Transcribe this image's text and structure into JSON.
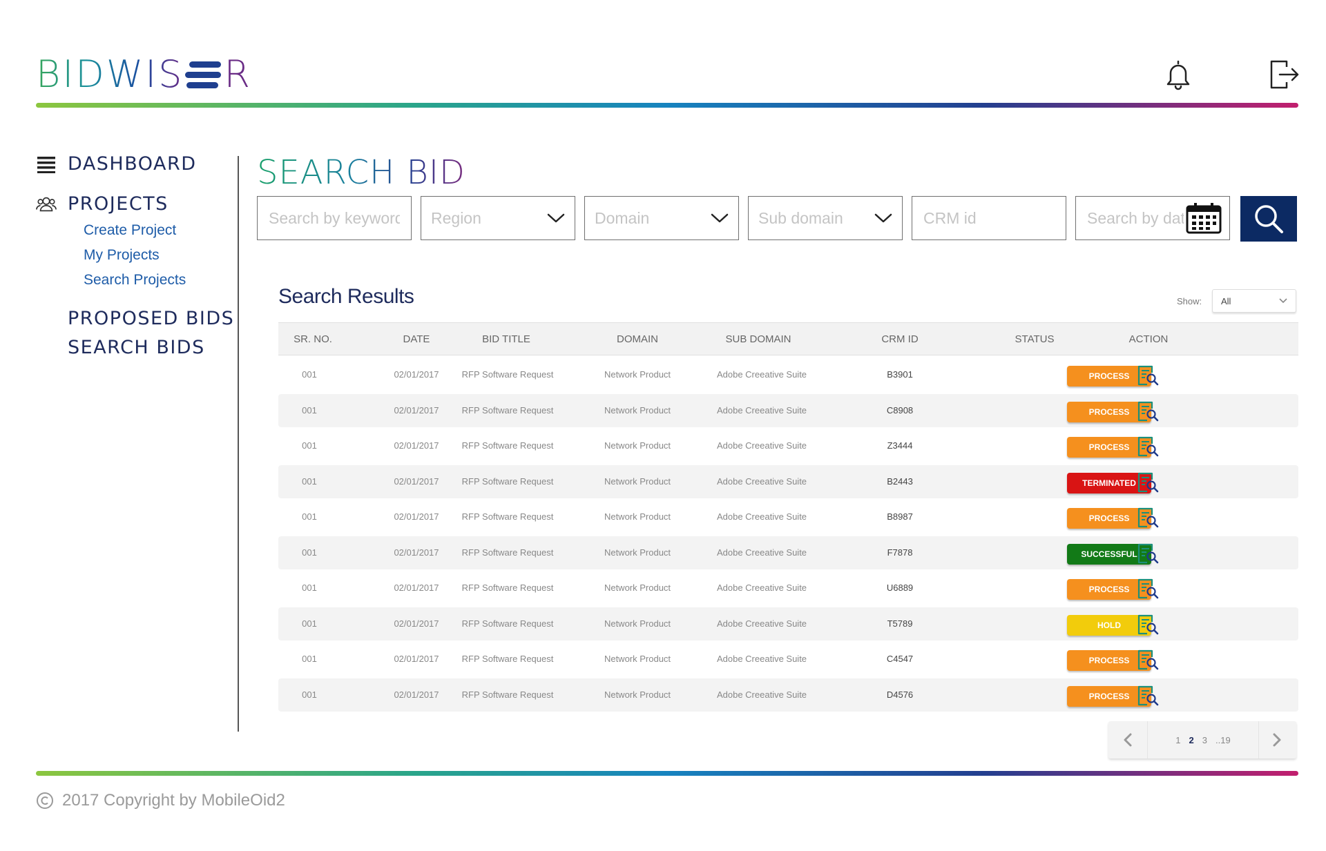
{
  "brand": {
    "logo_left": "BIDWIS",
    "logo_right": "R"
  },
  "header": {
    "bell_icon": "bell-icon",
    "logout_icon": "logout-icon"
  },
  "sidebar": {
    "dashboard": "DASHBOARD",
    "projects": "PROJECTS",
    "project_items": [
      "Create Project",
      "My Projects",
      "Search Projects"
    ],
    "proposed_bids": "PROPOSED BIDS",
    "search_bids": "SEARCH BIDS"
  },
  "page": {
    "title": "SEARCH BID"
  },
  "filters": {
    "keyword_placeholder": "Search by keyword",
    "region_placeholder": "Region",
    "domain_placeholder": "Domain",
    "subdomain_placeholder": "Sub domain",
    "crm_placeholder": "CRM id",
    "date_placeholder": "Search by date"
  },
  "results": {
    "title": "Search Results",
    "show_label": "Show:",
    "show_value": "All",
    "columns": [
      "SR. NO.",
      "DATE",
      "BID TITLE",
      "DOMAIN",
      "SUB DOMAIN",
      "CRM ID",
      "STATUS",
      "ACTION"
    ],
    "rows": [
      {
        "sr": "001",
        "date": "02/01/2017",
        "title": "RFP Software Request",
        "domain": "Network Product",
        "subdomain": "Adobe Creeative Suite",
        "crm": "B3901",
        "status": "PROCESS"
      },
      {
        "sr": "001",
        "date": "02/01/2017",
        "title": "RFP Software Request",
        "domain": "Network Product",
        "subdomain": "Adobe Creeative Suite",
        "crm": "C8908",
        "status": "PROCESS"
      },
      {
        "sr": "001",
        "date": "02/01/2017",
        "title": "RFP Software Request",
        "domain": "Network Product",
        "subdomain": "Adobe Creeative Suite",
        "crm": "Z3444",
        "status": "PROCESS"
      },
      {
        "sr": "001",
        "date": "02/01/2017",
        "title": "RFP Software Request",
        "domain": "Network Product",
        "subdomain": "Adobe Creeative Suite",
        "crm": "B2443",
        "status": "TERMINATED"
      },
      {
        "sr": "001",
        "date": "02/01/2017",
        "title": "RFP Software Request",
        "domain": "Network Product",
        "subdomain": "Adobe Creeative Suite",
        "crm": "B8987",
        "status": "PROCESS"
      },
      {
        "sr": "001",
        "date": "02/01/2017",
        "title": "RFP Software Request",
        "domain": "Network Product",
        "subdomain": "Adobe Creeative Suite",
        "crm": "F7878",
        "status": "SUCCESSFUL"
      },
      {
        "sr": "001",
        "date": "02/01/2017",
        "title": "RFP Software Request",
        "domain": "Network Product",
        "subdomain": "Adobe Creeative Suite",
        "crm": "U6889",
        "status": "PROCESS"
      },
      {
        "sr": "001",
        "date": "02/01/2017",
        "title": "RFP Software Request",
        "domain": "Network Product",
        "subdomain": "Adobe Creeative Suite",
        "crm": "T5789",
        "status": "HOLD"
      },
      {
        "sr": "001",
        "date": "02/01/2017",
        "title": "RFP Software Request",
        "domain": "Network Product",
        "subdomain": "Adobe Creeative Suite",
        "crm": "C4547",
        "status": "PROCESS"
      },
      {
        "sr": "001",
        "date": "02/01/2017",
        "title": "RFP Software Request",
        "domain": "Network Product",
        "subdomain": "Adobe Creeative Suite",
        "crm": "D4576",
        "status": "PROCESS"
      }
    ],
    "action_icon": "view-document-icon"
  },
  "status_colors": {
    "PROCESS": "#f5901e",
    "TERMINATED": "#d91414",
    "SUCCESSFUL": "#127a17",
    "HOLD": "#f2cc0c"
  },
  "pagination": {
    "pages": [
      "1",
      "2",
      "3",
      "..19"
    ],
    "current": "2"
  },
  "footer": {
    "copyright": "2017 Copyright by MobileOid2"
  },
  "colors": {
    "primary_dark": "#0c2a63",
    "nav_text": "#1e2b5c",
    "link": "#1e5ca8",
    "action_icon": "#1b8f7a"
  }
}
